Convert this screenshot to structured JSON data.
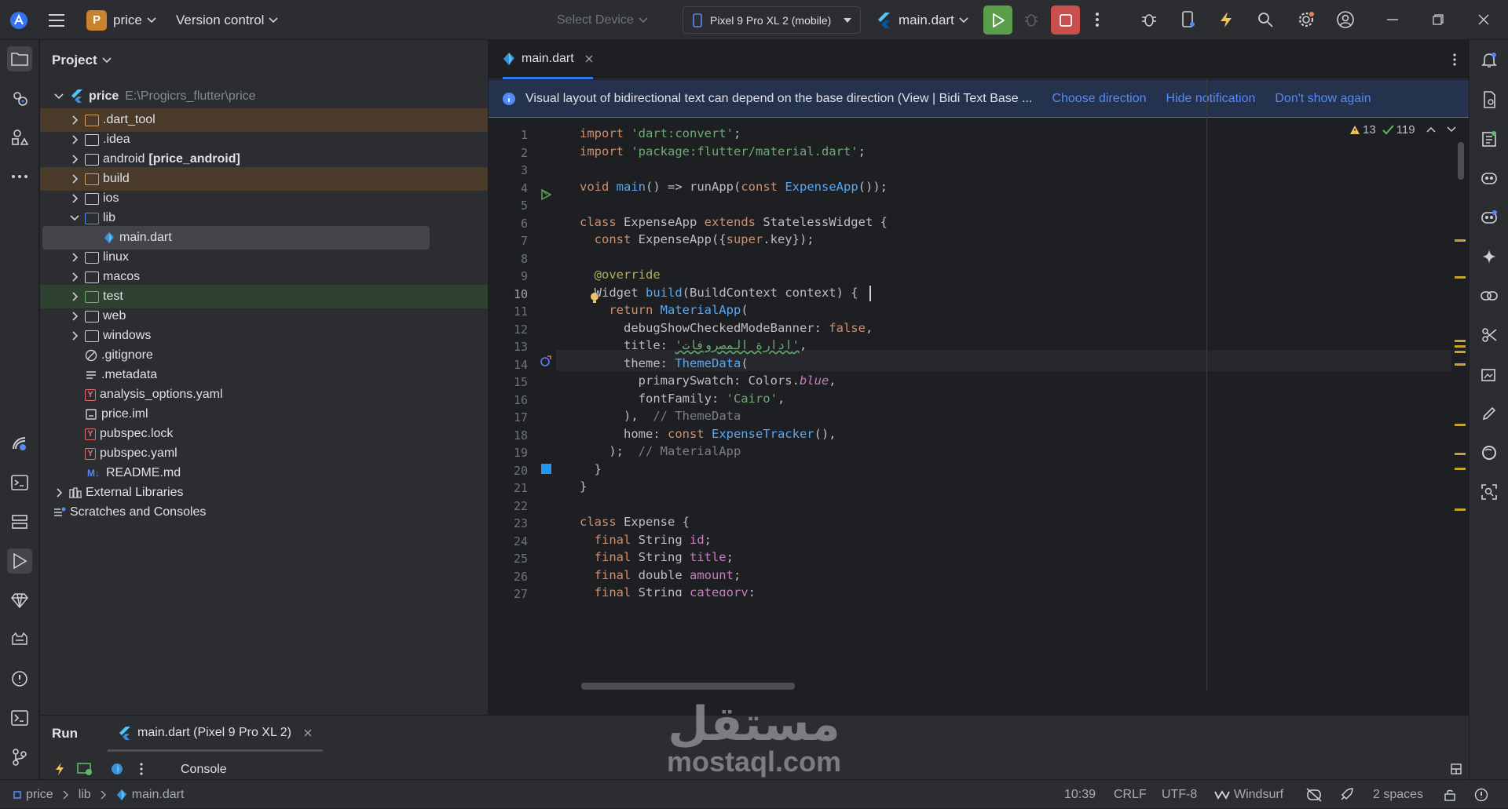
{
  "titlebar": {
    "project_badge": "P",
    "project_name": "price",
    "vcs": "Version control",
    "select_device": "Select Device",
    "device": "Pixel 9 Pro XL 2 (mobile)",
    "run_config": "main.dart"
  },
  "project_panel": {
    "title": "Project",
    "root_name": "price",
    "root_path": "E:\\Progicrs_flutter\\price",
    "items": [
      {
        "label": ".dart_tool",
        "kind": "folder-orange"
      },
      {
        "label": ".idea",
        "kind": "folder"
      },
      {
        "label": "android",
        "suffix": "[price_android]",
        "kind": "folder"
      },
      {
        "label": "build",
        "kind": "folder-orange"
      },
      {
        "label": "ios",
        "kind": "folder"
      },
      {
        "label": "lib",
        "kind": "folder-blue"
      },
      {
        "label": "main.dart",
        "kind": "dart"
      },
      {
        "label": "linux",
        "kind": "folder"
      },
      {
        "label": "macos",
        "kind": "folder"
      },
      {
        "label": "test",
        "kind": "folder-green"
      },
      {
        "label": "web",
        "kind": "folder"
      },
      {
        "label": "windows",
        "kind": "folder"
      },
      {
        "label": ".gitignore",
        "kind": "ignore"
      },
      {
        "label": ".metadata",
        "kind": "text"
      },
      {
        "label": "analysis_options.yaml",
        "kind": "yaml"
      },
      {
        "label": "price.iml",
        "kind": "iml"
      },
      {
        "label": "pubspec.lock",
        "kind": "yaml"
      },
      {
        "label": "pubspec.yaml",
        "kind": "yaml"
      },
      {
        "label": "README.md",
        "kind": "md"
      },
      {
        "label": "External Libraries",
        "kind": "lib"
      },
      {
        "label": "Scratches and Consoles",
        "kind": "scratch"
      }
    ]
  },
  "editor": {
    "tab_label": "main.dart",
    "notification": {
      "text": "Visual layout of bidirectional text can depend on the base direction (View | Bidi Text Base ...",
      "choose": "Choose direction",
      "hide": "Hide notification",
      "dont": "Don't show again"
    },
    "warnings": "13",
    "checks": "119",
    "line_numbers": [
      "1",
      "2",
      "3",
      "4",
      "5",
      "6",
      "7",
      "8",
      "9",
      "10",
      "11",
      "12",
      "13",
      "14",
      "15",
      "16",
      "17",
      "18",
      "19",
      "20",
      "21",
      "22",
      "23",
      "24",
      "25",
      "26",
      "27"
    ],
    "code": {
      "l1a": "import ",
      "l1b": "'dart:convert'",
      "l1c": ";",
      "l2a": "import ",
      "l2b": "'package:flutter/material.dart'",
      "l2c": ";",
      "l4a": "void ",
      "l4b": "main",
      "l4c": "() => runApp(",
      "l4d": "const ",
      "l4e": "ExpenseApp",
      "l4f": "());",
      "l6a": "class ",
      "l6b": "ExpenseApp ",
      "l6c": "extends ",
      "l6d": "StatelessWidget {",
      "l7a": "  const ",
      "l7b": "ExpenseApp({",
      "l7c": "super",
      "l7d": ".key});",
      "l9": "  @override",
      "l10a": "  Widget ",
      "l10b": "build",
      "l10c": "(BuildContext context) {",
      "l11a": "    return ",
      "l11b": "MaterialApp",
      "l11c": "(",
      "l12a": "      debugShowCheckedModeBanner: ",
      "l12b": "false",
      "l12c": ",",
      "l13a": "      title: ",
      "l13b": "'ادارة المصروفات'",
      "l13c": ",",
      "l14a": "      theme: ",
      "l14b": "ThemeData",
      "l14c": "(",
      "l15a": "        primarySwatch: Colors.",
      "l15b": "blue",
      "l15c": ",",
      "l16a": "        fontFamily: ",
      "l16b": "'Cairo'",
      "l16c": ",",
      "l17a": "      ),  ",
      "l17b": "// ThemeData",
      "l18a": "      home: ",
      "l18b": "const ",
      "l18c": "ExpenseTracker",
      "l18d": "(),",
      "l19a": "    );  ",
      "l19b": "// MaterialApp",
      "l20": "  }",
      "l21": "}",
      "l23a": "class ",
      "l23b": "Expense {",
      "l24a": "  final ",
      "l24b": "String ",
      "l24c": "id",
      "l24d": ";",
      "l25a": "  final ",
      "l25b": "String ",
      "l25c": "title",
      "l25d": ";",
      "l26a": "  final ",
      "l26b": "double ",
      "l26c": "amount",
      "l26d": ";",
      "l27a": "  final ",
      "l27b": "String ",
      "l27c": "category",
      "l27d": ";"
    }
  },
  "run_panel": {
    "title": "Run",
    "tab": "main.dart (Pixel 9 Pro XL 2)",
    "console": "Console"
  },
  "watermark": {
    "arabic": "مستقل",
    "latin": "mostaql.com"
  },
  "statusbar": {
    "crumb1": "price",
    "crumb2": "lib",
    "crumb3": "main.dart",
    "position": "10:39",
    "line_sep": "CRLF",
    "encoding": "UTF-8",
    "windsurf": "Windsurf",
    "indent": "2 spaces"
  },
  "colors": {
    "accent": "#3574f0",
    "run": "#5a9e4c",
    "stop": "#c94f4f",
    "project_badge": "#c9832e"
  }
}
